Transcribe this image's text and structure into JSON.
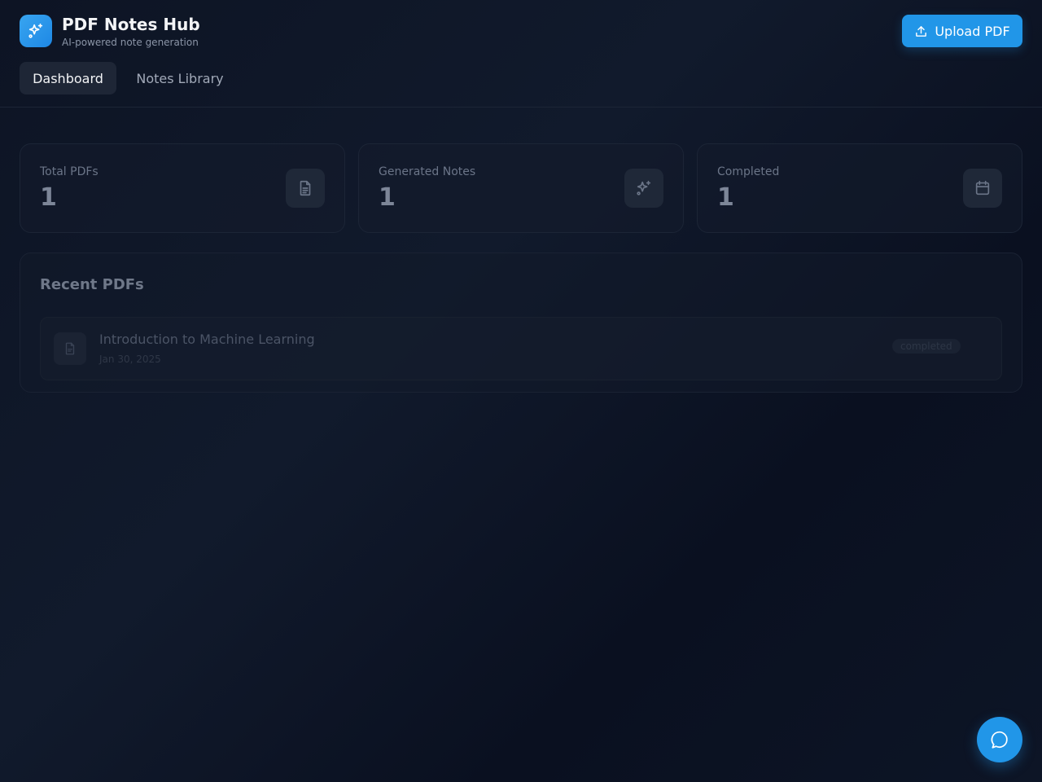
{
  "app": {
    "title": "PDF Notes Hub",
    "subtitle": "AI-powered note generation",
    "logo_icon": "sparkles-icon",
    "accent_color": "#2196e8"
  },
  "header": {
    "upload_label": "Upload PDF",
    "upload_icon": "upload-icon"
  },
  "tabs": [
    {
      "label": "Dashboard",
      "active": true
    },
    {
      "label": "Notes Library",
      "active": false
    }
  ],
  "stats": [
    {
      "label": "Total PDFs",
      "value": "1",
      "icon": "file-text-icon"
    },
    {
      "label": "Generated Notes",
      "value": "1",
      "icon": "sparkles-icon"
    },
    {
      "label": "Completed",
      "value": "1",
      "icon": "calendar-icon"
    }
  ],
  "recent": {
    "title": "Recent PDFs",
    "items": [
      {
        "title": "Introduction to Machine Learning",
        "date": "Jan 30, 2025",
        "status": "completed"
      }
    ]
  },
  "fab": {
    "icon": "chat-bubble-icon"
  }
}
